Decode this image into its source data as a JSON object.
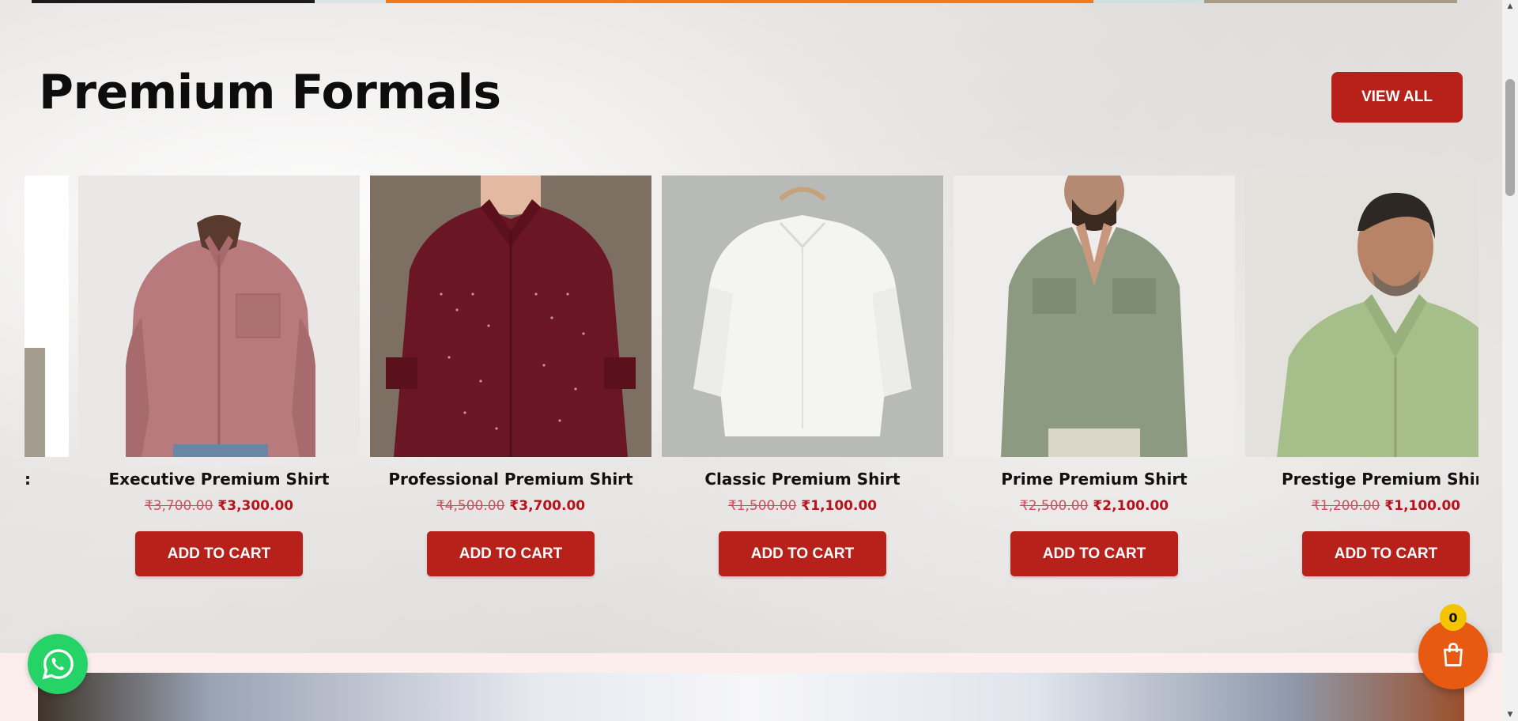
{
  "section": {
    "title": "Premium Formals",
    "view_all_label": "VIEW ALL"
  },
  "products": [
    {
      "name": "Executive Premium Shirt",
      "old_price": "₹3,700.00",
      "price": "₹3,300.00",
      "button": "ADD TO CART"
    },
    {
      "name": "Professional Premium Shirt",
      "old_price": "₹4,500.00",
      "price": "₹3,700.00",
      "button": "ADD TO CART"
    },
    {
      "name": "Classic Premium Shirt",
      "old_price": "₹1,500.00",
      "price": "₹1,100.00",
      "button": "ADD TO CART"
    },
    {
      "name": "Prime Premium Shirt",
      "old_price": "₹2,500.00",
      "price": "₹2,100.00",
      "button": "ADD TO CART"
    },
    {
      "name": "Prestige Premium Shirt",
      "old_price": "₹1,200.00",
      "price": "₹1,100.00",
      "button": "ADD TO CART"
    }
  ],
  "partial_card": {
    "label": ":"
  },
  "cart": {
    "count": "0"
  },
  "icons": {
    "whatsapp": "whatsapp-icon",
    "cart": "shopping-bag-icon"
  },
  "colors": {
    "accent": "#b8211a",
    "cart_fab": "#e85a12",
    "whatsapp": "#25d366",
    "badge": "#f5c400"
  }
}
